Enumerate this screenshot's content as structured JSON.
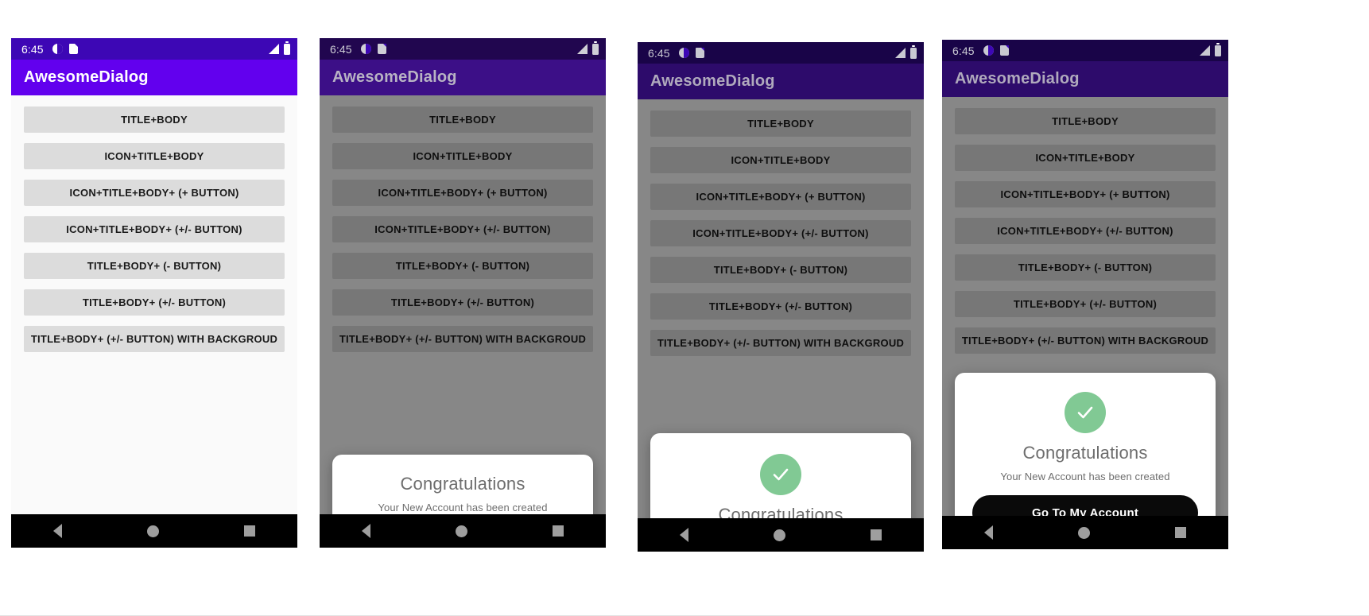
{
  "app": {
    "title": "AwesomeDialog",
    "status_time": "6:45",
    "status_icons": [
      "contrast-icon",
      "sd-card-icon",
      "signal-icon",
      "battery-icon"
    ],
    "nav_icons": [
      "back-icon",
      "home-icon",
      "recents-icon"
    ]
  },
  "options": [
    "TITLE+BODY",
    "ICON+TITLE+BODY",
    "ICON+TITLE+BODY+ (+ BUTTON)",
    "ICON+TITLE+BODY+ (+/- BUTTON)",
    "TITLE+BODY+ (- BUTTON)",
    "TITLE+BODY+ (+/- BUTTON)",
    "TITLE+BODY+ (+/- BUTTON) WITH BACKGROUD"
  ],
  "dialog": {
    "title": "Congratulations",
    "body": "Your New Account has been created",
    "button_label": "Go To My Account",
    "check_icon": "check-circle-icon"
  },
  "colors": {
    "accent_bright": "#6200ee",
    "accent_dim": "#3c0f87",
    "accent_dark": "#2d0b6b",
    "status_bright": "#3d07b5",
    "status_dim": "#21064f",
    "status_dark": "#190448",
    "button_face": "#dcdcdc",
    "button_face_dim": "#585858",
    "surface": "#fafafa",
    "scrim": "rgba(0,0,0,0.46)",
    "check_green": "#81c994",
    "cta_black": "#0a0a0a",
    "nav_black": "#000000",
    "nav_icon": "#9e9e9e",
    "dialog_text": "#6d6d6d"
  },
  "frames": [
    {
      "id": "frame-1",
      "state": "list-only",
      "dialog_variant": "none"
    },
    {
      "id": "frame-2",
      "state": "dialog-title",
      "dialog_variant": "title-body"
    },
    {
      "id": "frame-3",
      "state": "dialog-icon",
      "dialog_variant": "icon-title-body"
    },
    {
      "id": "frame-4",
      "state": "dialog-button",
      "dialog_variant": "icon-title-body-button"
    }
  ]
}
